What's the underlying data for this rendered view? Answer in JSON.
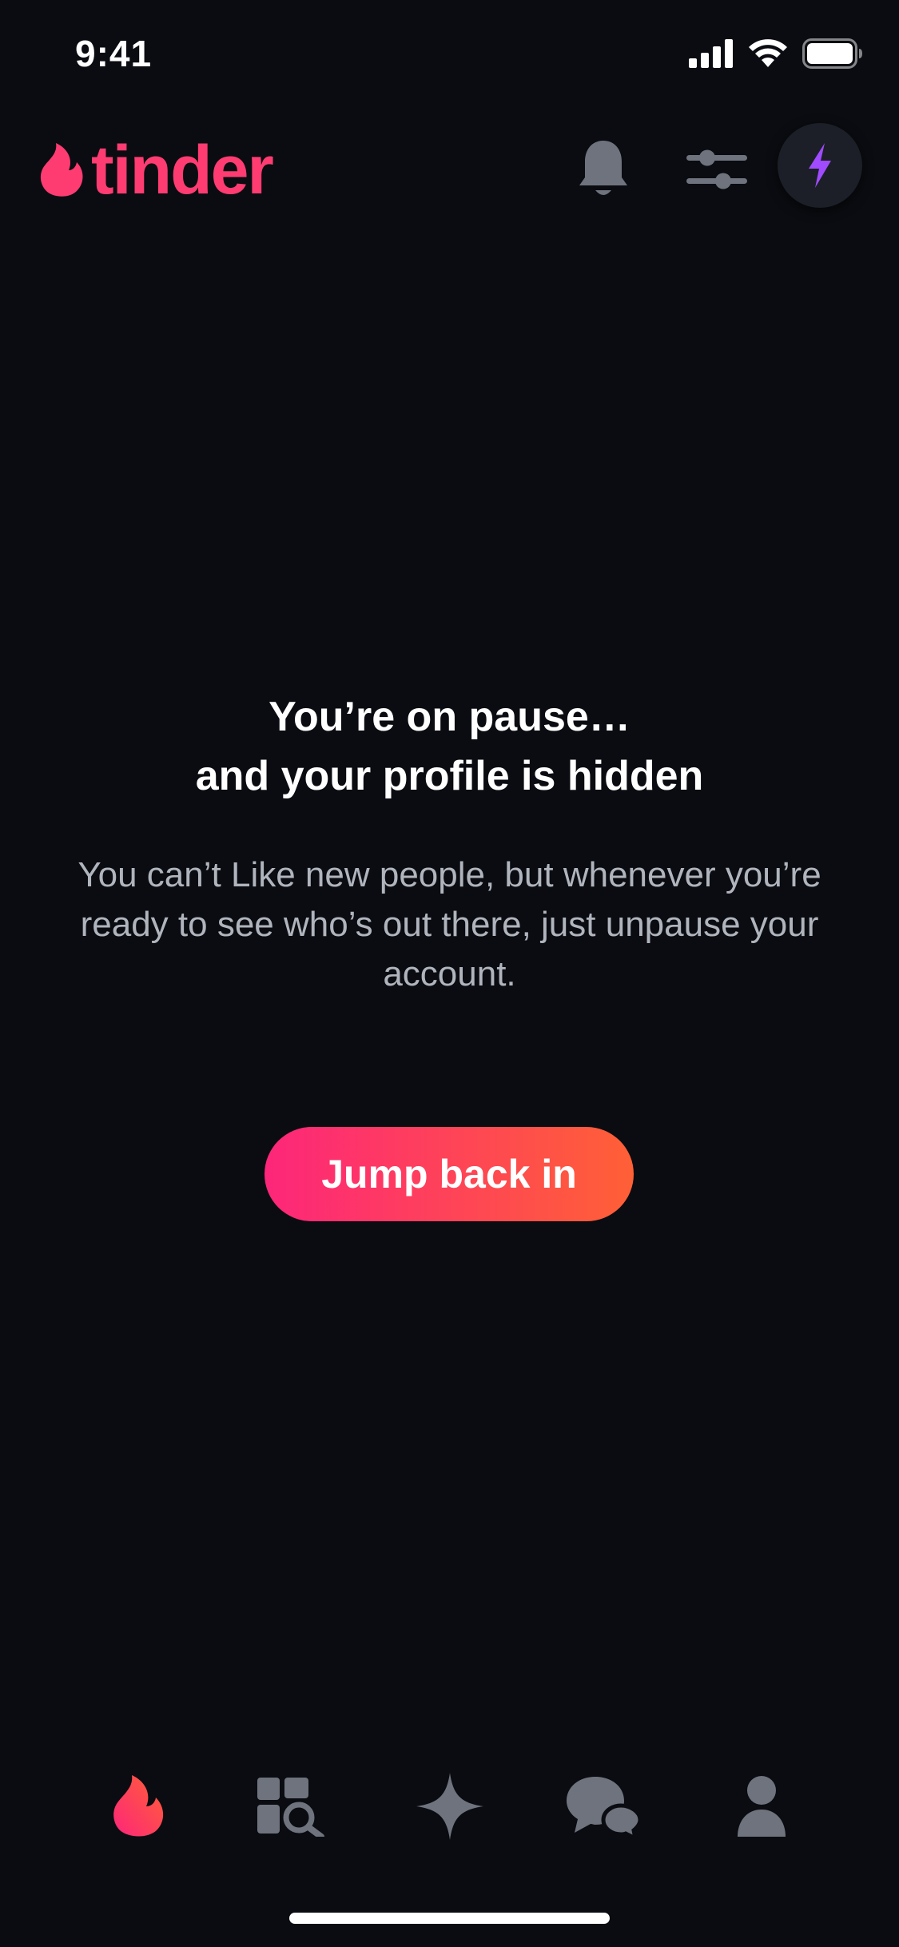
{
  "status_bar": {
    "time": "9:41"
  },
  "header": {
    "logo_text": "tinder",
    "icons": [
      "bell-icon",
      "filter-sliders-icon",
      "boost-bolt-icon"
    ]
  },
  "main": {
    "title_line1": "You’re on pause…",
    "title_line2": "and your profile is hidden",
    "subtitle": "You can’t Like new people, but whenever you’re ready to see who’s out there, just unpause your account.",
    "cta_label": "Jump back in"
  },
  "tab_bar": {
    "tabs": [
      {
        "icon": "flame-icon",
        "active": true
      },
      {
        "icon": "explore-icon",
        "active": false
      },
      {
        "icon": "sparkle-icon",
        "active": false
      },
      {
        "icon": "chat-icon",
        "active": false
      },
      {
        "icon": "profile-icon",
        "active": false
      }
    ]
  },
  "colors": {
    "background": "#0A0C11",
    "brand": "#FE3C72",
    "gradient_start": "#FD267A",
    "gradient_end": "#FF6036",
    "icon_gray": "#6E737D",
    "boost_purple": "#A04BFF"
  }
}
